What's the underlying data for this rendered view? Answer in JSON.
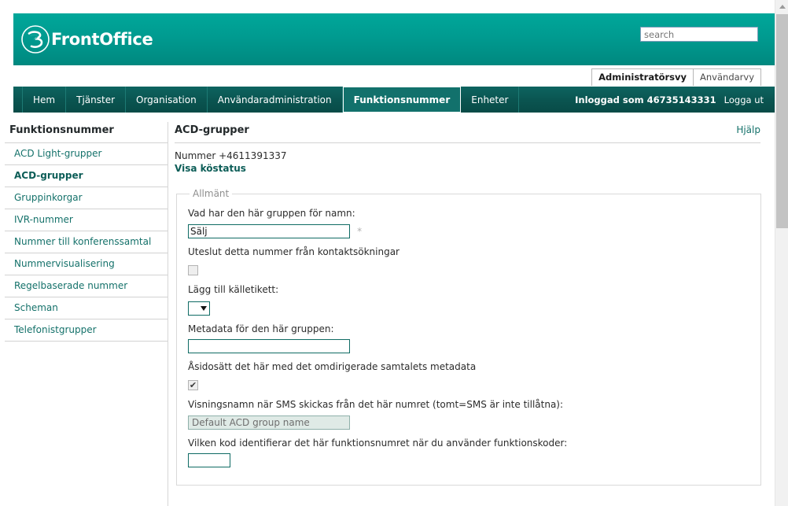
{
  "header": {
    "brand_name": "FrontOffice",
    "logo_icon": "three-logo-icon",
    "search": {
      "value": "",
      "placeholder": "search",
      "icon": "search-icon"
    }
  },
  "view_tabs": [
    {
      "label": "Administratörsvy",
      "active": true
    },
    {
      "label": "Användarvy",
      "active": false
    }
  ],
  "nav": {
    "items": [
      {
        "label": "Hem",
        "active": false
      },
      {
        "label": "Tjänster",
        "active": false
      },
      {
        "label": "Organisation",
        "active": false
      },
      {
        "label": "Användaradministration",
        "active": false
      },
      {
        "label": "Funktionsnummer",
        "active": true
      },
      {
        "label": "Enheter",
        "active": false
      }
    ],
    "logged_in_label": "Inloggad som 46735143331",
    "logout_label": "Logga ut"
  },
  "sidebar": {
    "title": "Funktionsnummer",
    "items": [
      {
        "label": "ACD Light-grupper",
        "active": false
      },
      {
        "label": "ACD-grupper",
        "active": true
      },
      {
        "label": "Gruppinkorgar",
        "active": false
      },
      {
        "label": "IVR-nummer",
        "active": false
      },
      {
        "label": "Nummer till konferenssamtal",
        "active": false
      },
      {
        "label": "Nummervisualisering",
        "active": false
      },
      {
        "label": "Regelbaserade nummer",
        "active": false
      },
      {
        "label": "Scheman",
        "active": false
      },
      {
        "label": "Telefonistgrupper",
        "active": false
      }
    ]
  },
  "main": {
    "title": "ACD-grupper",
    "help_label": "Hjälp",
    "number_line": "Nummer +4611391337",
    "queue_status_link": "Visa köstatus",
    "fieldset_legend": "Allmänt",
    "fields": {
      "group_name": {
        "label": "Vad har den här gruppen för namn:",
        "value": "Sälj",
        "required_marker": "*"
      },
      "exclude_from_search": {
        "label": "Uteslut detta nummer från kontaktsökningar",
        "checked": false
      },
      "source_label": {
        "label": "Lägg till källetikett:",
        "selected": "",
        "options": [
          ""
        ]
      },
      "group_metadata": {
        "label": "Metadata för den här gruppen:",
        "value": ""
      },
      "override_metadata": {
        "label": "Åsidosätt det här med det omdirigerade samtalets metadata",
        "checked": true,
        "check_glyph": "✔"
      },
      "sms_display_name": {
        "label": "Visningsnamn när SMS skickas från det här numret (tomt=SMS är inte tillåtna):",
        "value": "Default ACD group name",
        "disabled": true
      },
      "function_code": {
        "label": "Vilken kod identifierar det här funktionsnumret när du använder funktionskoder:",
        "value": ""
      }
    }
  },
  "colors": {
    "brand_teal": "#00a79a",
    "nav_dark_teal": "#0a5450",
    "link_teal": "#14716a",
    "input_border": "#0f6b64",
    "disabled_field_bg": "#dfeae6"
  },
  "scrollbar": {
    "up_arrow_icon": "triangle-up-icon",
    "position": "top"
  }
}
